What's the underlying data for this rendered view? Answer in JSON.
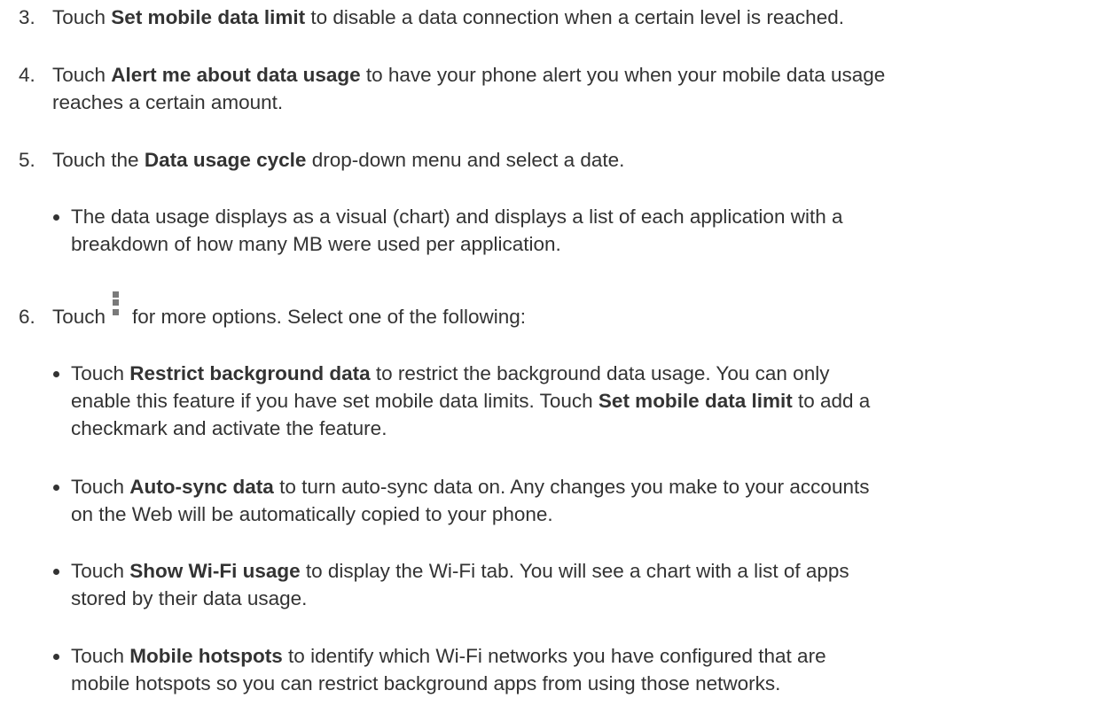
{
  "step3": {
    "num": "3.",
    "pre": "Touch ",
    "bold": "Set mobile data limit",
    "post": " to disable a data connection when a certain level is reached."
  },
  "step4": {
    "num": "4.",
    "pre": "Touch ",
    "bold": "Alert me about data usage",
    "post1": " to have your phone alert you when your mobile data usage",
    "line2": "reaches a certain amount."
  },
  "step5": {
    "num": "5.",
    "pre": "Touch the ",
    "bold": "Data usage cycle",
    "post": " drop-down menu and select a date.",
    "bullet": {
      "line1": "The data usage displays as a visual (chart) and displays a list of each application with a",
      "line2": "breakdown of how many MB were used per application."
    }
  },
  "step6": {
    "num": "6.",
    "pre": "Touch",
    "icon": "overflow-menu-icon",
    "post": "for more options. Select one of the following:",
    "bullets": [
      {
        "pre": "Touch ",
        "bold": "Restrict background data",
        "post1": " to restrict the background data usage. You can only",
        "line2": "enable this feature if you have set mobile data limits. Touch ",
        "bold2": "Set mobile data limit",
        "post2": " to add a",
        "line3": "checkmark and activate the feature."
      },
      {
        "pre": "Touch ",
        "bold": "Auto-sync data",
        "post1": " to turn auto-sync data on. Any changes you make to your accounts",
        "line2": "on the Web will be automatically copied to your phone."
      },
      {
        "pre": "Touch ",
        "bold": "Show Wi-Fi usage",
        "post1": " to display the Wi-Fi tab. You will see a chart with a list of apps",
        "line2": "stored by their data usage."
      },
      {
        "pre": "Touch ",
        "bold": "Mobile hotspots",
        "post1": " to identify which Wi-Fi networks you have configured that are",
        "line2": "mobile hotspots so you can restrict background apps from using those networks."
      }
    ]
  }
}
